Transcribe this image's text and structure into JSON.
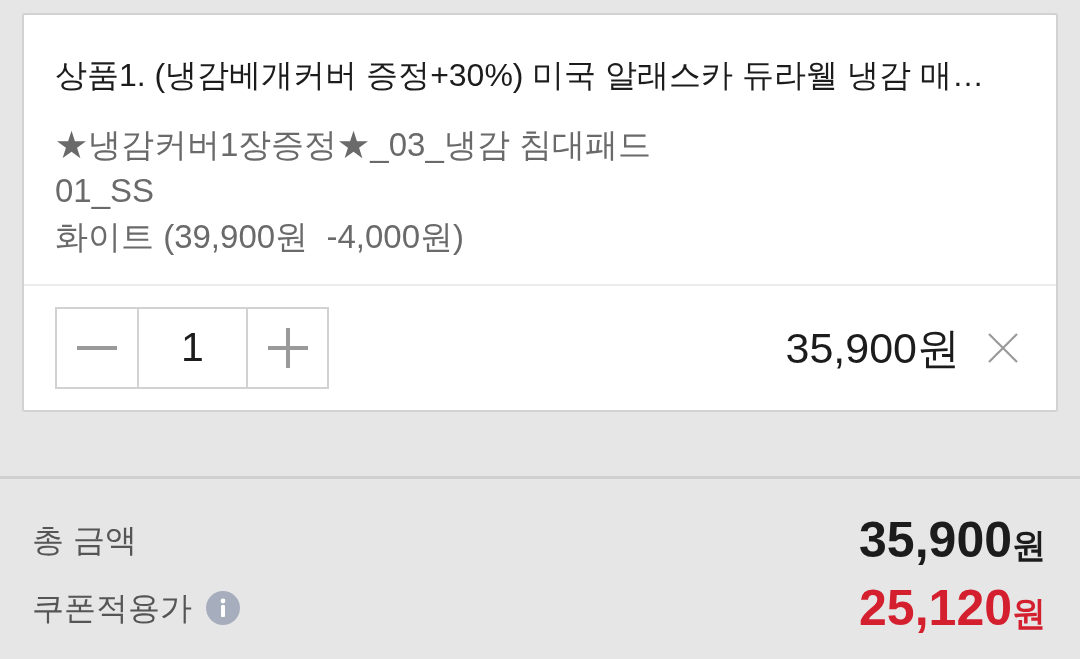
{
  "cart_item": {
    "title": "상품1. (냉감베개커버 증정+30%) 미국 알래스카 듀라웰 냉감 매…",
    "options": [
      "★냉감커버1장증정★_03_냉감 침대패드",
      "01_SS",
      "화이트 (39,900원  -4,000원)"
    ],
    "quantity": "1",
    "price": "35,900원"
  },
  "summary": {
    "rows": [
      {
        "kind": "total",
        "label": "총 금액",
        "info": false,
        "amount": "35,900",
        "unit": "원"
      },
      {
        "kind": "coupon",
        "label": "쿠폰적용가",
        "info": true,
        "amount": "25,120",
        "unit": "원"
      }
    ]
  }
}
